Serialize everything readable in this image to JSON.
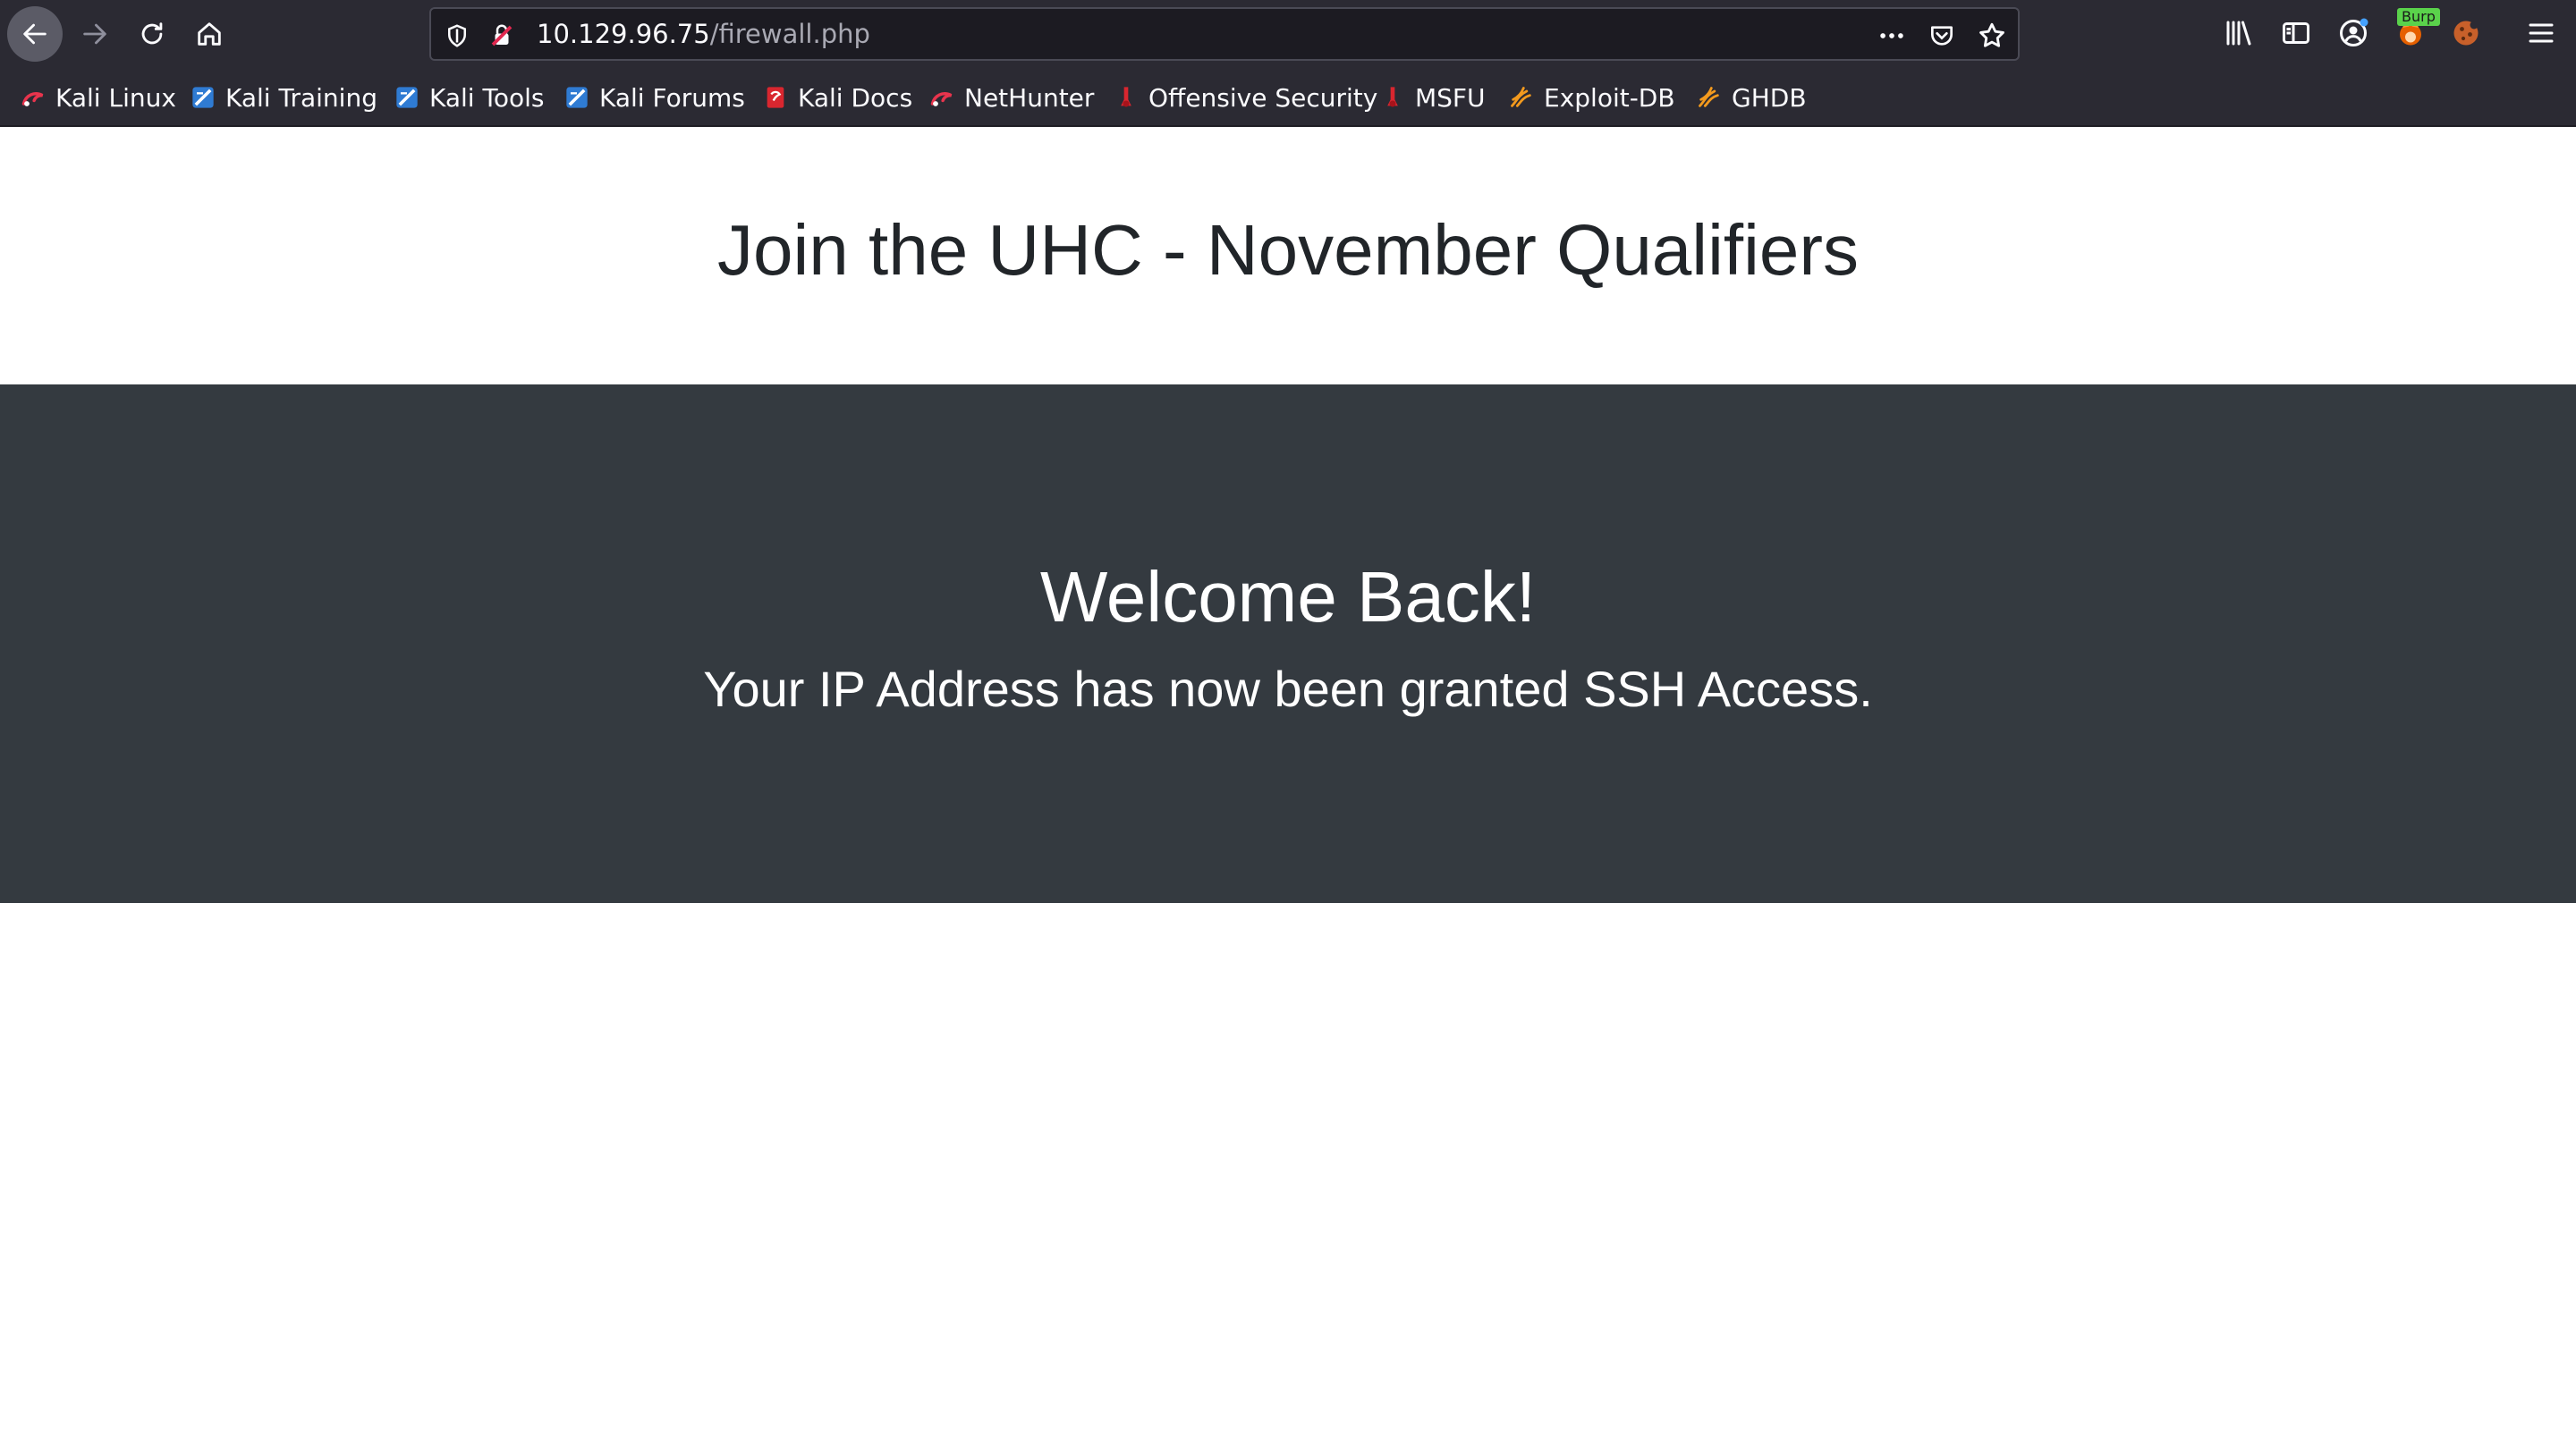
{
  "browser": {
    "url_host": "10.129.96.75",
    "url_path": "/firewall.php",
    "burp_badge": "Burp",
    "bookmarks": [
      {
        "label": "Kali Linux",
        "icon": "kali-dragon-icon"
      },
      {
        "label": "Kali Training",
        "icon": "kali-training-icon"
      },
      {
        "label": "Kali Tools",
        "icon": "kali-tools-icon"
      },
      {
        "label": "Kali Forums",
        "icon": "kali-forums-icon"
      },
      {
        "label": "Kali Docs",
        "icon": "kali-docs-icon"
      },
      {
        "label": "NetHunter",
        "icon": "nethunter-icon"
      },
      {
        "label": "Offensive Security",
        "icon": "offsec-icon"
      },
      {
        "label": "MSFU",
        "icon": "msfu-icon"
      },
      {
        "label": "Exploit-DB",
        "icon": "exploitdb-icon"
      },
      {
        "label": "GHDB",
        "icon": "ghdb-icon"
      }
    ]
  },
  "page": {
    "title": "Join the UHC - November Qualifiers",
    "hero_title": "Welcome Back!",
    "hero_subtitle": "Your IP Address has now been granted SSH Access."
  },
  "colors": {
    "chrome_bg": "#2b2a33",
    "hero_bg": "#343a40",
    "title_text": "#212529"
  }
}
